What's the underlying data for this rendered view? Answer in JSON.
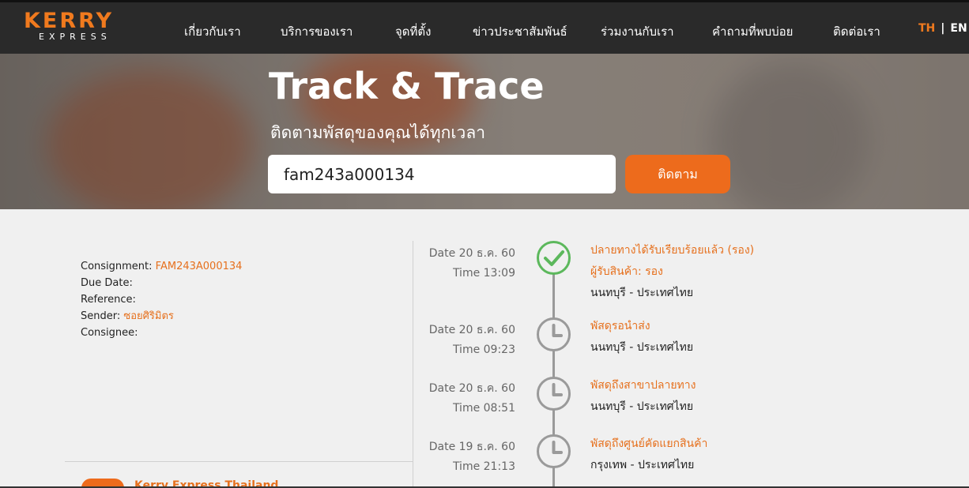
{
  "brand": {
    "name_top": "KERRY",
    "name_bottom": "EXPRESS",
    "accent": "#f07a1e"
  },
  "nav": {
    "items": [
      "เกี่ยวกับเรา",
      "บริการของเรา",
      "จุดที่ตั้ง",
      "ข่าวประชาสัมพันธ์",
      "ร่วมงานกับเรา",
      "คำถามที่พบบ่อย",
      "ติดต่อเรา"
    ],
    "lang_th": "TH",
    "lang_sep": "|",
    "lang_en": "EN"
  },
  "hero": {
    "title": "Track & Trace",
    "subtitle": "ติดตามพัสดุของคุณได้ทุกเวลา",
    "search_value": "fam243a000134",
    "button_label": "ติดตาม"
  },
  "details": {
    "consignment_label": "Consignment:",
    "consignment_value": "FAM243A000134",
    "due_date_label": "Due Date:",
    "reference_label": "Reference:",
    "sender_label": "Sender:",
    "sender_value": "ซอยศิริมิตร",
    "consignee_label": "Consignee:"
  },
  "timeline": [
    {
      "date": "Date 20 ธ.ค. 60",
      "time": "Time 13:09",
      "icon": "check-circle-icon",
      "status": "ปลายทางได้รับเรียบร้อยแล้ว (รอง)",
      "receiver": "ผู้รับสินค้า: รอง",
      "location": "นนทบุรี - ประเทศไทย"
    },
    {
      "date": "Date 20 ธ.ค. 60",
      "time": "Time 09:23",
      "icon": "clock-icon",
      "status": "พัสดุรอนำส่ง",
      "location": "นนทบุรี - ประเทศไทย"
    },
    {
      "date": "Date 20 ธ.ค. 60",
      "time": "Time 08:51",
      "icon": "clock-icon",
      "status": "พัสดุถึงสาขาปลายทาง",
      "location": "นนทบุรี - ประเทศไทย"
    },
    {
      "date": "Date 19 ธ.ค. 60",
      "time": "Time 21:13",
      "icon": "clock-icon",
      "status": "พัสดุถึงศูนย์คัดแยกสินค้า",
      "location": "กรุงเทพ - ประเทศไทย"
    }
  ],
  "footer_partial": "Kerry Express Thailand",
  "colors": {
    "orange": "#ed6b1c",
    "nav_bg": "#2a2a2a",
    "page_bg": "#f0f0f0",
    "check_green": "#5cb85c",
    "timeline_grey": "#9a9a9a"
  }
}
